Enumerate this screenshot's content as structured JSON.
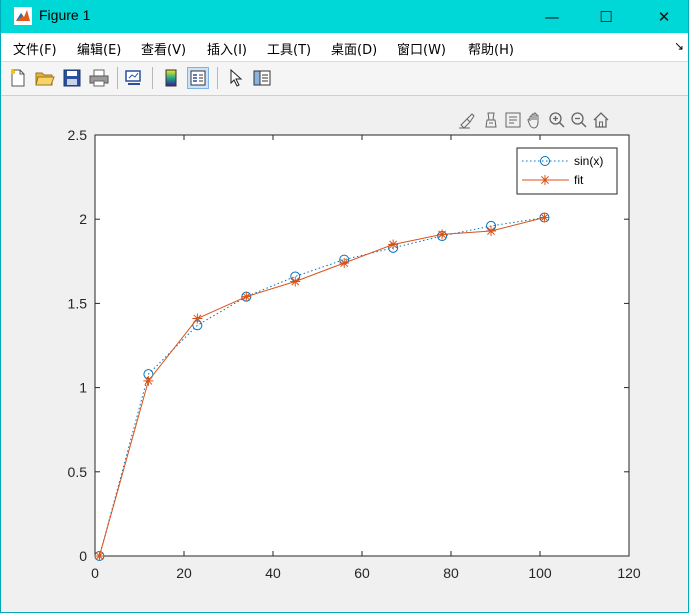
{
  "window": {
    "title": "Figure 1",
    "controls": {
      "minimize": "—",
      "maximize": "☐",
      "close": "✕"
    }
  },
  "menu": {
    "items": [
      {
        "label": "文件(F)"
      },
      {
        "label": "编辑(E)"
      },
      {
        "label": "查看(V)"
      },
      {
        "label": "插入(I)"
      },
      {
        "label": "工具(T)"
      },
      {
        "label": "桌面(D)"
      },
      {
        "label": "窗口(W)"
      },
      {
        "label": "帮助(H)"
      }
    ],
    "overflow_icon": "chevron-icon"
  },
  "toolbar": {
    "icons": [
      "new-figure-icon",
      "open-file-icon",
      "save-icon",
      "print-icon",
      "link-plot-icon",
      "insert-colorbar-icon",
      "insert-legend-icon",
      "edit-plot-icon",
      "property-inspector-icon"
    ]
  },
  "axes_toolbar": {
    "icons": [
      "brush-icon",
      "data-tips-icon",
      "export-icon",
      "pan-icon",
      "zoom-in-icon",
      "zoom-out-icon",
      "home-icon"
    ]
  },
  "chart_data": {
    "type": "line",
    "xlim": [
      0,
      120
    ],
    "ylim": [
      0,
      2.5
    ],
    "xticks": [
      0,
      20,
      40,
      60,
      80,
      100,
      120
    ],
    "yticks": [
      0,
      0.5,
      1,
      1.5,
      2,
      2.5
    ],
    "xtick_labels": [
      "0",
      "20",
      "40",
      "60",
      "80",
      "100",
      "120"
    ],
    "ytick_labels": [
      "0",
      "0.5",
      "1",
      "1.5",
      "2",
      "2.5"
    ],
    "grid": false,
    "legend_position": "top-right",
    "series": [
      {
        "name": "sin(x)",
        "style": "dotted-circle",
        "color": "#0072bd",
        "x": [
          1,
          12,
          23,
          34,
          45,
          56,
          67,
          78,
          89,
          101
        ],
        "y": [
          0.0,
          1.08,
          1.37,
          1.54,
          1.66,
          1.76,
          1.83,
          1.9,
          1.96,
          2.01
        ]
      },
      {
        "name": "fit",
        "style": "solid-asterisk",
        "color": "#d95319",
        "x": [
          1,
          12,
          23,
          34,
          45,
          56,
          67,
          78,
          89,
          101
        ],
        "y": [
          0.0,
          1.04,
          1.41,
          1.54,
          1.63,
          1.74,
          1.85,
          1.91,
          1.93,
          2.01
        ]
      }
    ]
  }
}
